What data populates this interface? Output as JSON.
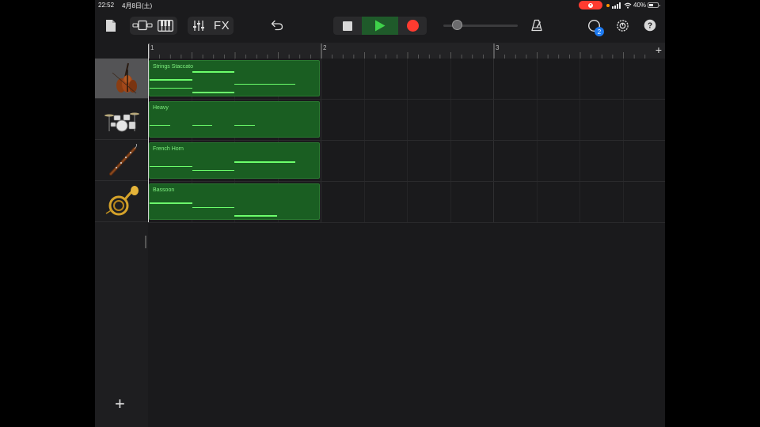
{
  "status_bar": {
    "time": "22:52",
    "date": "4月8日(土)",
    "battery_percent": "40%",
    "recording_color": "#ff3b30"
  },
  "toolbar": {
    "fx_label": "FX",
    "notifications_badge": "2",
    "transport": {
      "play_active": true,
      "record_color": "#ff3b30",
      "play_color": "#3fd14a"
    },
    "icons": [
      "document-icon",
      "track-view-icon",
      "keyboard-icon",
      "mixer-icon",
      "undo-icon",
      "stop-icon",
      "play-icon",
      "record-icon",
      "metronome-icon",
      "loop-browser-icon",
      "settings-icon",
      "help-icon"
    ]
  },
  "ruler": {
    "bars": [
      "1",
      "2",
      "3"
    ],
    "add_label": "+"
  },
  "tracks": [
    {
      "name": "Strings Staccato",
      "instrument_icon": "cello-icon",
      "selected": true,
      "notes": [
        {
          "start": 0.0,
          "length": 0.25,
          "row": 2
        },
        {
          "start": 0.0,
          "length": 0.25,
          "row": 4
        },
        {
          "start": 0.25,
          "length": 0.25,
          "row": 0
        },
        {
          "start": 0.25,
          "length": 0.25,
          "row": 5
        },
        {
          "start": 0.5,
          "length": 0.36,
          "row": 3
        }
      ]
    },
    {
      "name": "Heavy",
      "instrument_icon": "drum-kit-icon",
      "selected": false,
      "notes": [
        {
          "start": 0.0,
          "length": 0.12,
          "row": 3
        },
        {
          "start": 0.25,
          "length": 0.12,
          "row": 3
        },
        {
          "start": 0.5,
          "length": 0.12,
          "row": 3
        }
      ]
    },
    {
      "name": "French Horn",
      "instrument_icon": "bassoon-icon",
      "selected": false,
      "notes": [
        {
          "start": 0.0,
          "length": 0.25,
          "row": 3
        },
        {
          "start": 0.25,
          "length": 0.25,
          "row": 4
        },
        {
          "start": 0.5,
          "length": 0.36,
          "row": 2
        }
      ]
    },
    {
      "name": "Bassoon",
      "instrument_icon": "french-horn-icon",
      "selected": false,
      "notes": [
        {
          "start": 0.0,
          "length": 0.25,
          "row": 2
        },
        {
          "start": 0.25,
          "length": 0.25,
          "row": 3
        },
        {
          "start": 0.5,
          "length": 0.25,
          "row": 5
        }
      ]
    }
  ],
  "add_track_label": "+",
  "colors": {
    "region_fill": "#1a5e22",
    "note": "#6cff6c",
    "region_title": "#7ff07f"
  }
}
